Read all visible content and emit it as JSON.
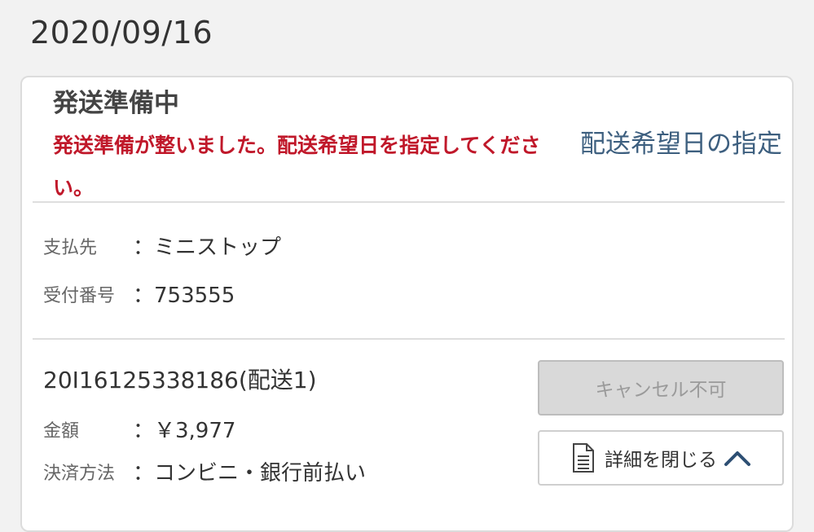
{
  "date": "2020/09/16",
  "status": {
    "title": "発送準備中",
    "message": "発送準備が整いました。配送希望日を指定してください。",
    "delivery_link": "配送希望日の指定"
  },
  "payment": {
    "payee_label": "支払先",
    "payee_value": "：ミニストップ",
    "receipt_label": "受付番号",
    "receipt_value": "：753555"
  },
  "order": {
    "id": "20I16125338186(配送1)",
    "amount_label": "金額",
    "amount_value": "：￥3,977",
    "method_label": "決済方法",
    "method_value": "：コンビニ・銀行前払い"
  },
  "buttons": {
    "cancel_label": "キャンセル不可",
    "detail_label": "詳細を閉じる"
  },
  "icons": {
    "detail": "document-list-icon",
    "collapse": "chevron-up-icon"
  },
  "colors": {
    "alert": "#c0182a",
    "link": "#3d5f7f",
    "chevron": "#2d4f73"
  }
}
